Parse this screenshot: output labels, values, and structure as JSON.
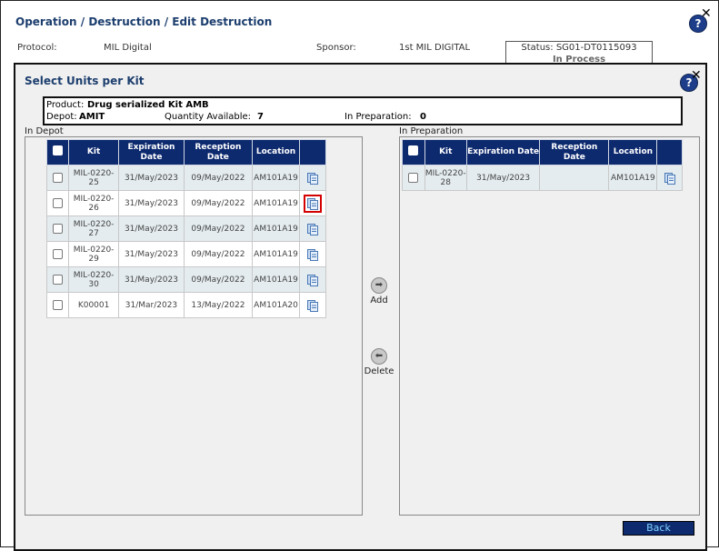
{
  "outer": {
    "breadcrumb": "Operation / Destruction / Edit Destruction",
    "protocol_label": "Protocol:",
    "protocol_value": "MIL Digital",
    "sponsor_label": "Sponsor:",
    "sponsor_value": "1st MIL DIGITAL",
    "status_line1": "Status: SG01-DT0115093",
    "status_line2": "In Process"
  },
  "modal": {
    "title": "Select Units per Kit",
    "product_label": "Product:",
    "product_value": "Drug serialized Kit AMB",
    "depot_label": "Depot:",
    "depot_value": "AMIT",
    "qty_label": "Quantity Available:",
    "qty_value": "7",
    "inprep_label": "In Preparation:",
    "inprep_value": "0"
  },
  "left_panel": {
    "label": "In Depot",
    "columns": [
      "Kit",
      "Expiration Date",
      "Reception Date",
      "Location"
    ],
    "rows": [
      {
        "kit": "MIL-0220-25",
        "exp": "31/May/2023",
        "rec": "09/May/2022",
        "loc": "AM101A19"
      },
      {
        "kit": "MIL-0220-26",
        "exp": "31/May/2023",
        "rec": "09/May/2022",
        "loc": "AM101A19"
      },
      {
        "kit": "MIL-0220-27",
        "exp": "31/May/2023",
        "rec": "09/May/2022",
        "loc": "AM101A19"
      },
      {
        "kit": "MIL-0220-29",
        "exp": "31/May/2023",
        "rec": "09/May/2022",
        "loc": "AM101A19"
      },
      {
        "kit": "MIL-0220-30",
        "exp": "31/May/2023",
        "rec": "09/May/2022",
        "loc": "AM101A19"
      },
      {
        "kit": "K00001",
        "exp": "31/Mar/2023",
        "rec": "13/May/2022",
        "loc": "AM101A20"
      }
    ]
  },
  "right_panel": {
    "label": "In Preparation",
    "columns": [
      "Kit",
      "Expiration Date",
      "Reception Date",
      "Location"
    ],
    "rows": [
      {
        "kit": "MIL-0220-28",
        "exp": "31/May/2023",
        "rec": "",
        "loc": "AM101A19"
      }
    ]
  },
  "actions": {
    "add": "Add",
    "delete": "Delete"
  },
  "back_label": "Back",
  "colors": {
    "header_bg": "#0e2a6e",
    "title_color": "#1c3e6e",
    "highlight": "#d40000"
  }
}
